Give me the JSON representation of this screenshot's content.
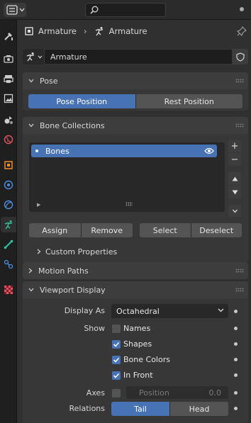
{
  "topbar": {
    "editor_icon": "properties-editor-icon",
    "search_icon": "search-icon"
  },
  "sidebar": {
    "tabs": [
      {
        "icon": "tool-icon"
      },
      {
        "icon": "render-icon"
      },
      {
        "icon": "output-icon"
      },
      {
        "icon": "view-layer-icon"
      },
      {
        "icon": "scene-icon"
      },
      {
        "icon": "world-icon"
      },
      {
        "icon": "object-icon"
      },
      {
        "icon": "modifiers-icon"
      },
      {
        "icon": "physics-icon"
      },
      {
        "icon": "armature-data-icon",
        "active": true
      },
      {
        "icon": "bone-icon"
      },
      {
        "icon": "bone-constraint-icon"
      },
      {
        "icon": "texture-icon"
      }
    ]
  },
  "breadcrumb": {
    "object": "Armature",
    "data": "Armature"
  },
  "datablock": {
    "name": "Armature"
  },
  "pose": {
    "title": "Pose",
    "pose_position": "Pose Position",
    "rest_position": "Rest Position",
    "selected": "pose_position"
  },
  "bone_collections": {
    "title": "Bone Collections",
    "items": [
      {
        "name": "Bones",
        "visible": true
      }
    ],
    "assign": "Assign",
    "remove": "Remove",
    "select": "Select",
    "deselect": "Deselect",
    "custom_properties": "Custom Properties"
  },
  "motion_paths": {
    "title": "Motion Paths"
  },
  "viewport_display": {
    "title": "Viewport Display",
    "display_as_label": "Display As",
    "display_as_value": "Octahedral",
    "show_label": "Show",
    "names": {
      "label": "Names",
      "checked": false
    },
    "shapes": {
      "label": "Shapes",
      "checked": true
    },
    "bone_colors": {
      "label": "Bone Colors",
      "checked": true
    },
    "in_front": {
      "label": "In Front",
      "checked": true
    },
    "axes_label": "Axes",
    "axes_checked": false,
    "position_label": "Position",
    "position_value": "0.0",
    "relations_label": "Relations",
    "relations_tail": "Tail",
    "relations_head": "Head",
    "relations_selected": "tail"
  },
  "colors": {
    "accent": "#4772b3",
    "background": "#303030",
    "panel_header": "#3d3d3d",
    "armature_tab_icon": "#2fc0a0"
  }
}
